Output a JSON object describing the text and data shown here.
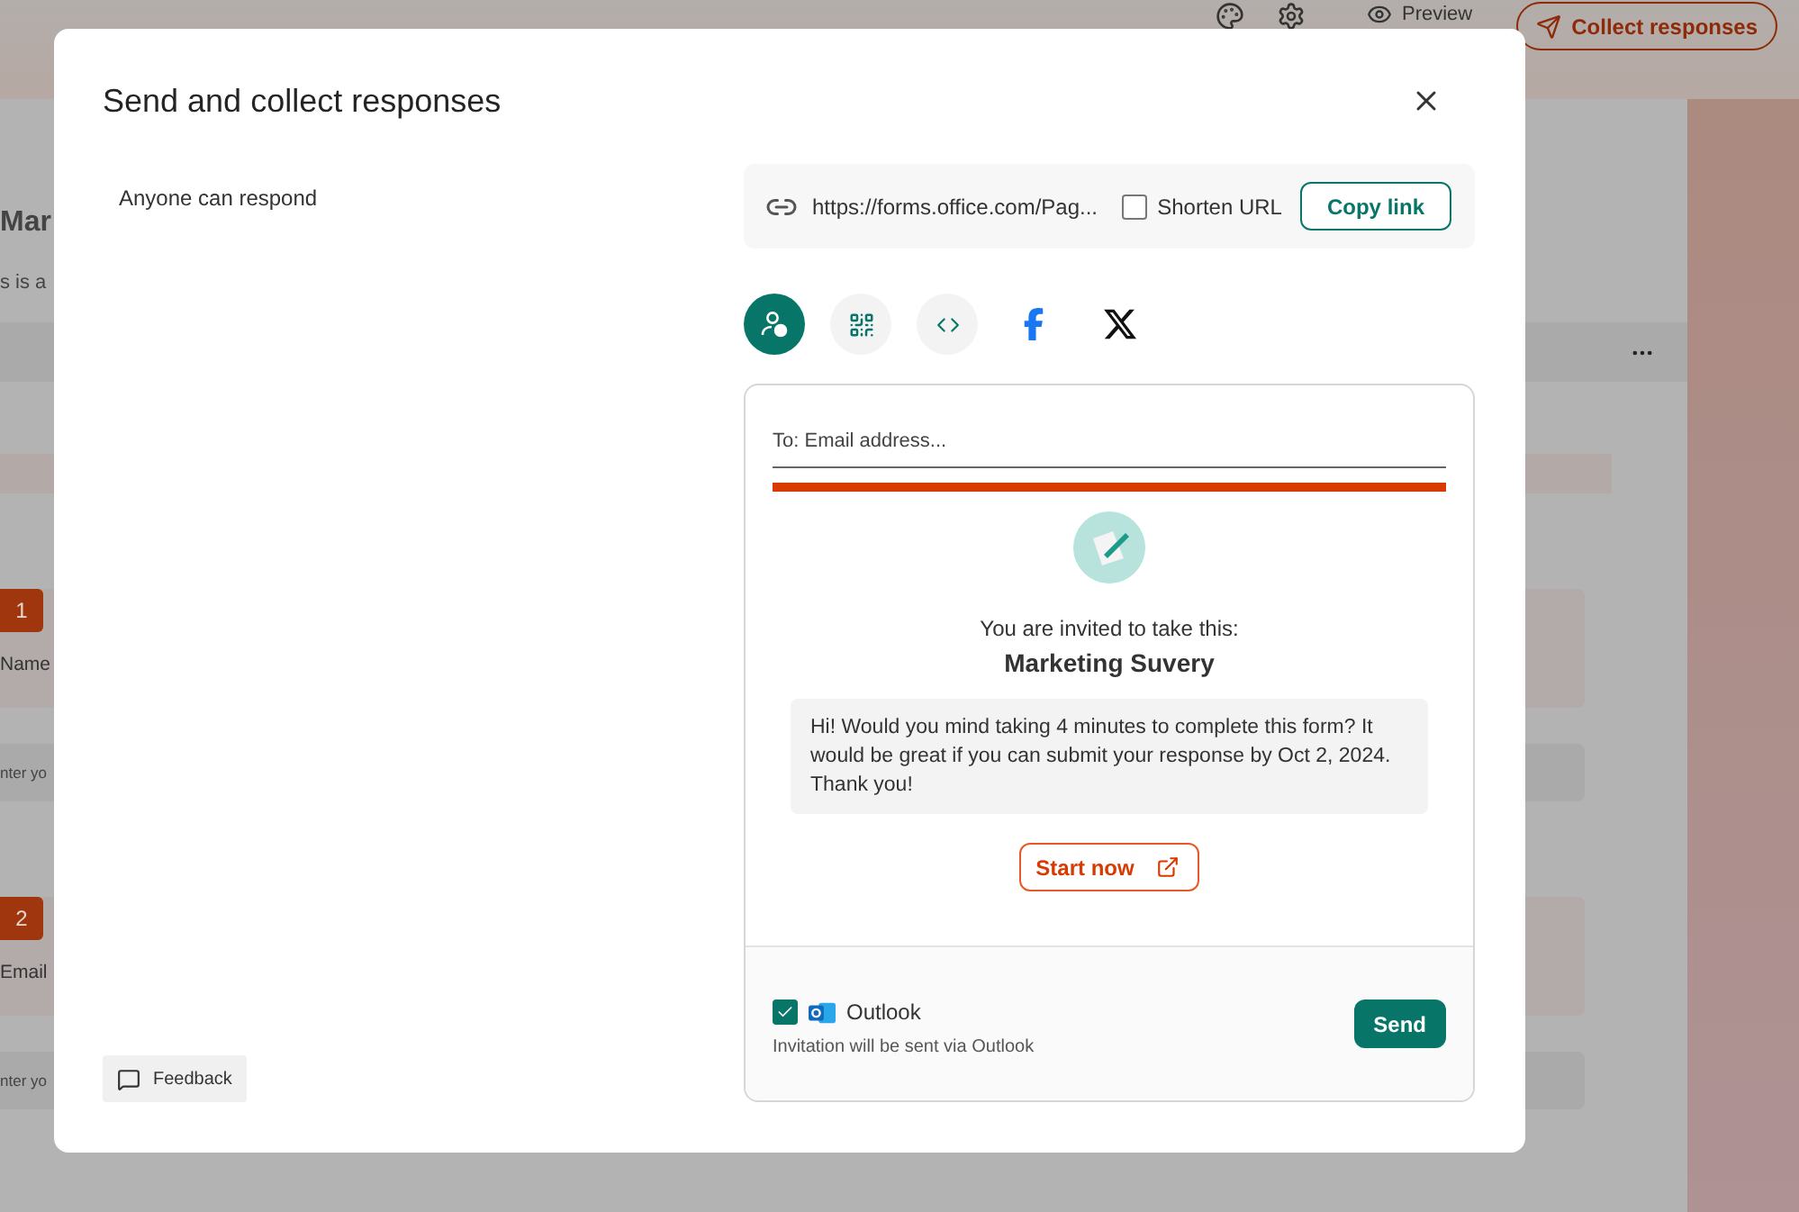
{
  "topbar": {
    "preview_button": "Preview",
    "collect_button": "Collect responses"
  },
  "background_form": {
    "title": "Mar",
    "description": "s is a",
    "questions": [
      {
        "number": "1",
        "label": "Name",
        "placeholder": "nter yo"
      },
      {
        "number": "2",
        "label": "Email",
        "placeholder": "nter yo"
      }
    ]
  },
  "dialog": {
    "title": "Send and collect responses",
    "audience": "Anyone can respond",
    "link": {
      "url": "https://forms.office.com/Pag...",
      "shorten_url": {
        "label": "Shorten URL",
        "checked": false
      },
      "copy_button": "Copy link"
    },
    "share_options": [
      {
        "kind": "email",
        "selected": true
      },
      {
        "kind": "qr",
        "selected": false
      },
      {
        "kind": "embed",
        "selected": false
      },
      {
        "kind": "facebook",
        "selected": false
      },
      {
        "kind": "x",
        "selected": false
      }
    ],
    "email": {
      "placeholder": "To: Email address..."
    },
    "invite": {
      "intro": "You are invited to take this:",
      "form_title": "Marketing Suvery",
      "message": "Hi! Would you mind taking 4 minutes to complete this form? It would be great if you can submit your response by Oct 2, 2024. Thank you!",
      "start_button": "Start now"
    },
    "send_via": {
      "label": "Outlook",
      "checked": true,
      "note": "Invitation will be sent via Outlook"
    },
    "send_button": "Send",
    "feedback_button": "Feedback"
  }
}
